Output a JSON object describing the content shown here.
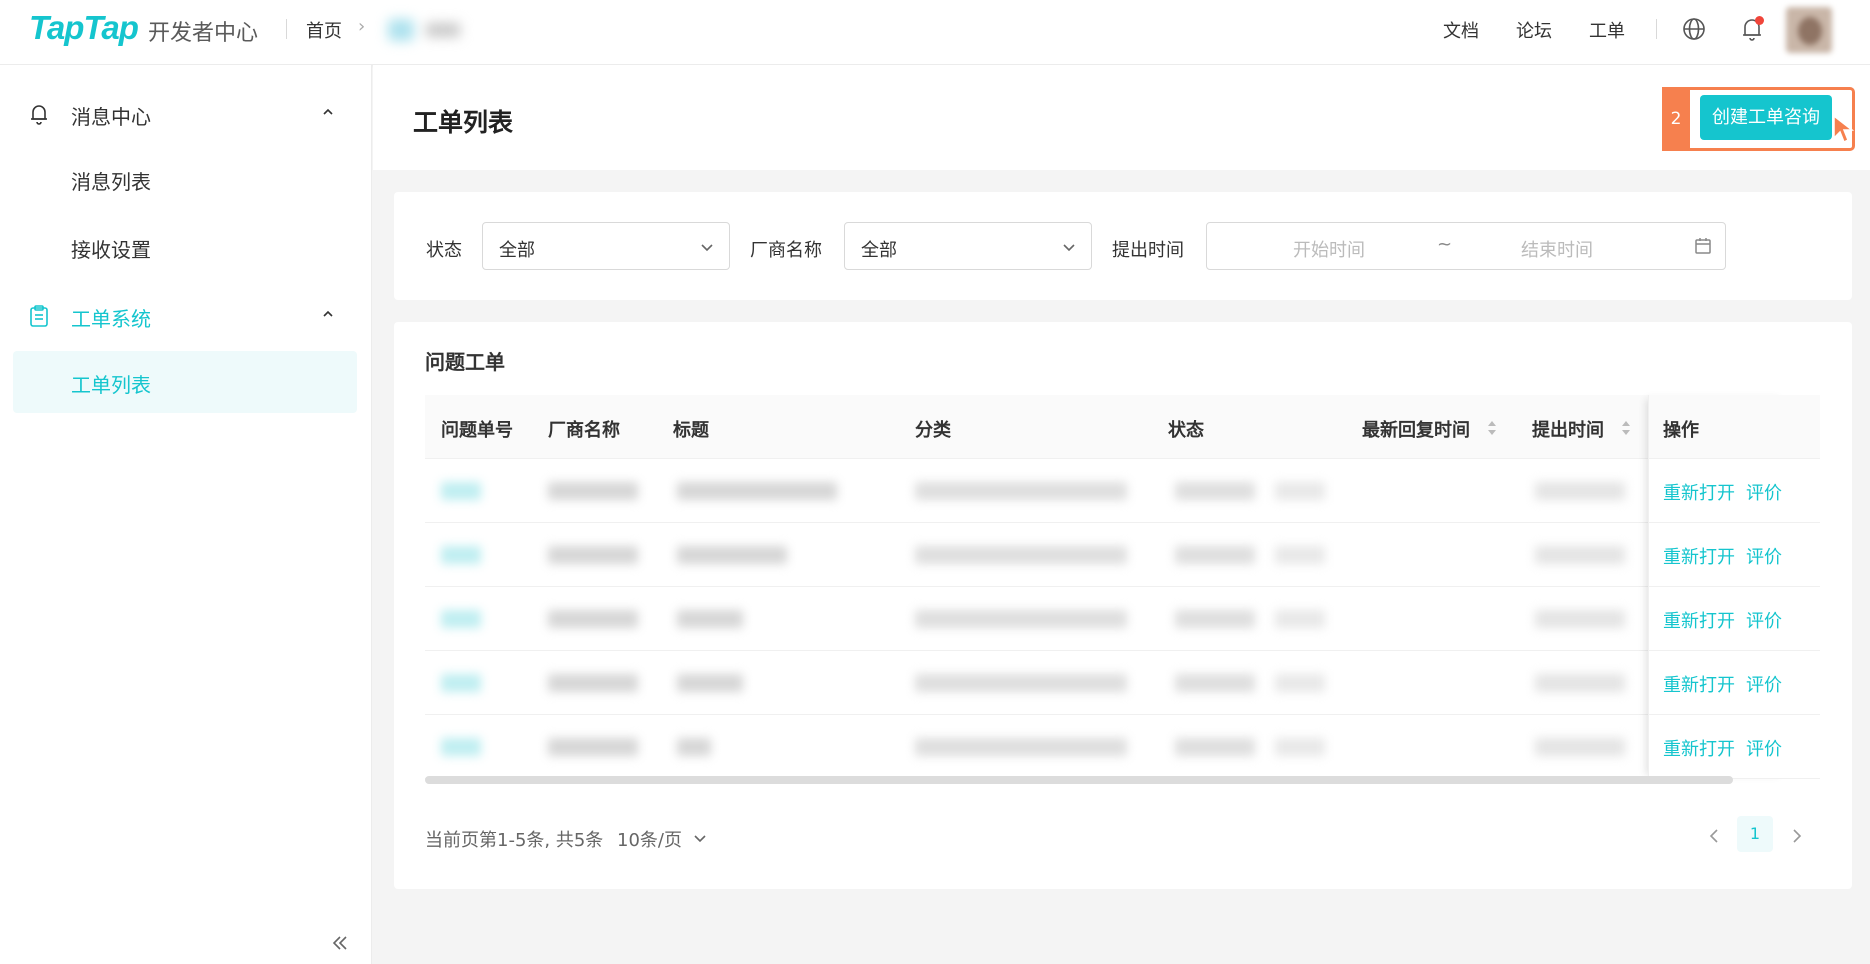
{
  "header": {
    "logo": "TapTap",
    "logo_subtitle": "开发者中心",
    "breadcrumb_home": "首页",
    "nav": [
      "文档",
      "论坛",
      "工单"
    ]
  },
  "sidebar": {
    "groups": [
      {
        "label": "消息中心",
        "icon": "bell-icon",
        "items": [
          "消息列表",
          "接收设置"
        ]
      },
      {
        "label": "工单系统",
        "icon": "clipboard-icon",
        "items": [
          "工单列表"
        ]
      }
    ],
    "active_item": "工单列表"
  },
  "page": {
    "title": "工单列表",
    "step_number": "2",
    "create_button": "创建工单咨询"
  },
  "filters": {
    "status_label": "状态",
    "status_value": "全部",
    "vendor_label": "厂商名称",
    "vendor_value": "全部",
    "time_label": "提出时间",
    "start_placeholder": "开始时间",
    "range_separator": "~",
    "end_placeholder": "结束时间"
  },
  "table": {
    "title": "问题工单",
    "columns": [
      "问题单号",
      "厂商名称",
      "标题",
      "分类",
      "状态",
      "最新回复时间",
      "提出时间",
      "操作"
    ],
    "rows": [
      {
        "reopen": "重新打开",
        "rate": "评价"
      },
      {
        "reopen": "重新打开",
        "rate": "评价"
      },
      {
        "reopen": "重新打开",
        "rate": "评价"
      },
      {
        "reopen": "重新打开",
        "rate": "评价"
      },
      {
        "reopen": "重新打开",
        "rate": "评价"
      }
    ]
  },
  "pagination": {
    "info": "当前页第1-5条, 共5条",
    "page_size": "10条/页",
    "current_page": "1"
  },
  "colors": {
    "accent": "#15c5ce",
    "highlight": "#f6804e",
    "notification_dot": "#f0453a"
  }
}
